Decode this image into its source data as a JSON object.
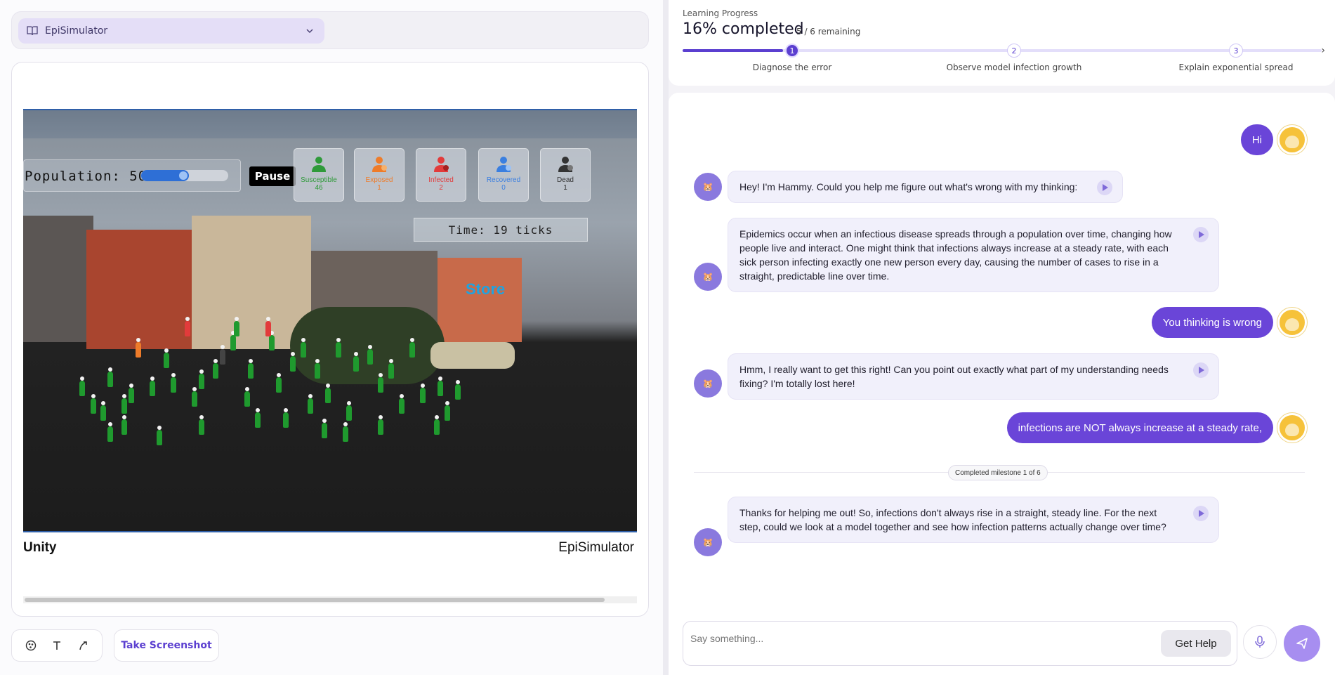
{
  "simulator": {
    "selected": "EpiSimulator"
  },
  "scene": {
    "population_label": "Population: 50",
    "population_fill": 0.55,
    "pause_label": "Pause",
    "stats": [
      {
        "label": "Susceptible",
        "value": "46",
        "color": "#2f9a3a"
      },
      {
        "label": "Exposed",
        "value": "1",
        "color": "#ee7c2a"
      },
      {
        "label": "Infected",
        "value": "2",
        "color": "#e23b3b"
      },
      {
        "label": "Recovered",
        "value": "0",
        "color": "#3a7fe0"
      },
      {
        "label": "Dead",
        "value": "1",
        "color": "#333333"
      }
    ],
    "time_label": "Time: 19 ticks",
    "store_sign": "Store",
    "unity_logo": "Unity",
    "unity_title": "EpiSimulator"
  },
  "toolbar": {
    "screenshot_label": "Take Screenshot"
  },
  "progress": {
    "label": "Learning Progress",
    "percent_text": "16% completed",
    "remaining_text": "5 / 6 remaining",
    "milestones": [
      {
        "num": "1",
        "label": "Diagnose the error",
        "active": true
      },
      {
        "num": "2",
        "label": "Observe model infection growth",
        "active": false
      },
      {
        "num": "3",
        "label": "Explain exponential spread",
        "active": false
      }
    ]
  },
  "chat": {
    "user_messages": [
      "Hi",
      "You thinking is wrong",
      "infections are NOT always increase at a steady rate,"
    ],
    "bot_messages": [
      "Hey! I'm Hammy. Could you help me figure out what's wrong with my thinking:",
      "Epidemics occur when an infectious disease spreads through a population over time, changing how people live and interact. One might think that infections always increase at a steady rate, with each sick person infecting exactly one new person every day, causing the number of cases to rise in a straight, predictable line over time.",
      "Hmm, I really want to get this right! Can you point out exactly what part of my understanding needs fixing? I'm totally lost here!",
      "Thanks for helping me out! So, infections don't always rise in a straight, steady line. For the next step, could we look at a model together and see how infection patterns actually change over time?"
    ],
    "milestone_pill": "Completed milestone 1 of 6"
  },
  "composer": {
    "placeholder": "Say something...",
    "help_label": "Get Help"
  },
  "colors": {
    "accent": "#5b3fd0",
    "user_bubble": "#6a45d8",
    "send": "#a78ef0"
  }
}
